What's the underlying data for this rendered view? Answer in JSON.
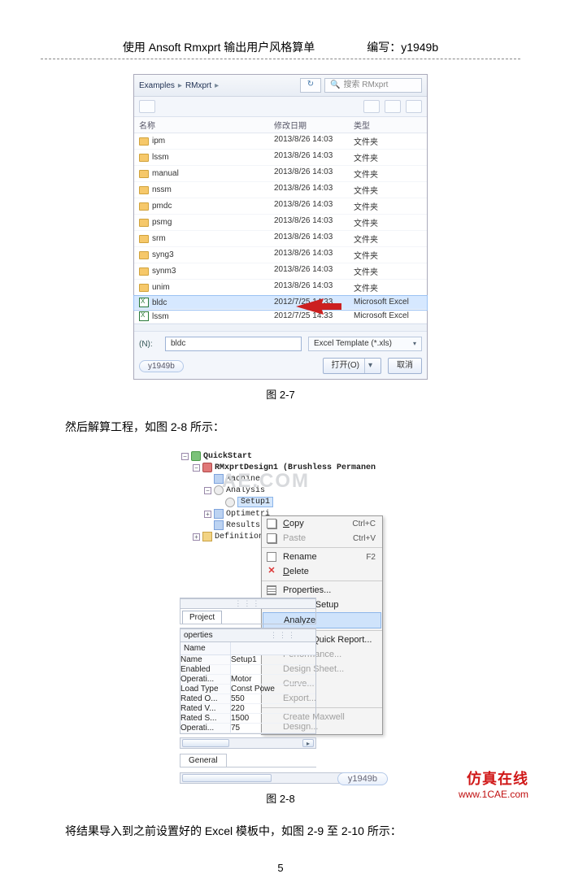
{
  "header": {
    "title": "使用 Ansoft Rmxprt 输出用户风格算单",
    "author_label": "编写：",
    "author": "y1949b"
  },
  "dlg": {
    "crumb1": "Examples",
    "crumb2": "RMxprt",
    "search_hint": "搜索 RMxprt",
    "cols": {
      "name": "名称",
      "date": "修改日期",
      "type": "类型"
    },
    "rows": [
      {
        "n": "ipm",
        "d": "2013/8/26 14:03",
        "t": "文件夹"
      },
      {
        "n": "lssm",
        "d": "2013/8/26 14:03",
        "t": "文件夹"
      },
      {
        "n": "manual",
        "d": "2013/8/26 14:03",
        "t": "文件夹"
      },
      {
        "n": "nssm",
        "d": "2013/8/26 14:03",
        "t": "文件夹"
      },
      {
        "n": "pmdc",
        "d": "2013/8/26 14:03",
        "t": "文件夹"
      },
      {
        "n": "psmg",
        "d": "2013/8/26 14:03",
        "t": "文件夹"
      },
      {
        "n": "srm",
        "d": "2013/8/26 14:03",
        "t": "文件夹"
      },
      {
        "n": "syng3",
        "d": "2013/8/26 14:03",
        "t": "文件夹"
      },
      {
        "n": "synm3",
        "d": "2013/8/26 14:03",
        "t": "文件夹"
      },
      {
        "n": "unim",
        "d": "2013/8/26 14:03",
        "t": "文件夹"
      },
      {
        "n": "bldc",
        "d": "2012/7/25 14:33",
        "t": "Microsoft Excel"
      },
      {
        "n": "lssm",
        "d": "2012/7/25 14:33",
        "t": "Microsoft Excel"
      }
    ],
    "fn_label": "(N):",
    "fn_value": "bldc",
    "ftype": "Excel Template (*.xls)",
    "open": "打开(O)",
    "cancel": "取消",
    "tag": "y1949b"
  },
  "cap27": "图 2-7",
  "para1": "然后解算工程，如图 2-8 所示：",
  "tree": {
    "root": "QuickStart",
    "design": "RMxprtDesign1 (Brushless Permanen",
    "machine": "Machine",
    "analysis": "Analysis",
    "setup": "Setup1",
    "opti": "Optimetri",
    "results": "Results",
    "defs": "Definitions",
    "watermark": "AE.COM"
  },
  "menu": {
    "copy": "Copy",
    "copy_sc": "Ctrl+C",
    "paste": "Paste",
    "paste_sc": "Ctrl+V",
    "rename": "Rename",
    "rename_sc": "F2",
    "delete": "Delete",
    "delete_u": "D",
    "props": "Properties...",
    "disable": "Disable Setup",
    "analyze": "Analyze",
    "cqr": "Create Quick Report...",
    "perf": "Performance...",
    "dsh": "Design Sheet...",
    "curve": "Curve...",
    "export": "Export...",
    "cmd": "Create Maxwell Design..."
  },
  "panel": {
    "project": "Project",
    "properties": "operties",
    "hname": "Name",
    "general": "General"
  },
  "props": [
    {
      "k": "Name",
      "v": "Setup1"
    },
    {
      "k": "Enabled",
      "v": ""
    },
    {
      "k": "Operati...",
      "v": "Motor"
    },
    {
      "k": "Load Type",
      "v": "Const Powe"
    },
    {
      "k": "Rated O...",
      "v": "550"
    },
    {
      "k": "Rated V...",
      "v": "220"
    },
    {
      "k": "Rated S...",
      "v": "1500"
    },
    {
      "k": "Operati...",
      "v": "75"
    }
  ],
  "ytag": "y1949b",
  "cap28": "图 2-8",
  "para2": "将结果导入到之前设置好的 Excel 模板中，如图 2-9 至 2-10 所示：",
  "page": "5",
  "footer": {
    "brand": "仿真在线",
    "url": "www.1CAE.com"
  }
}
